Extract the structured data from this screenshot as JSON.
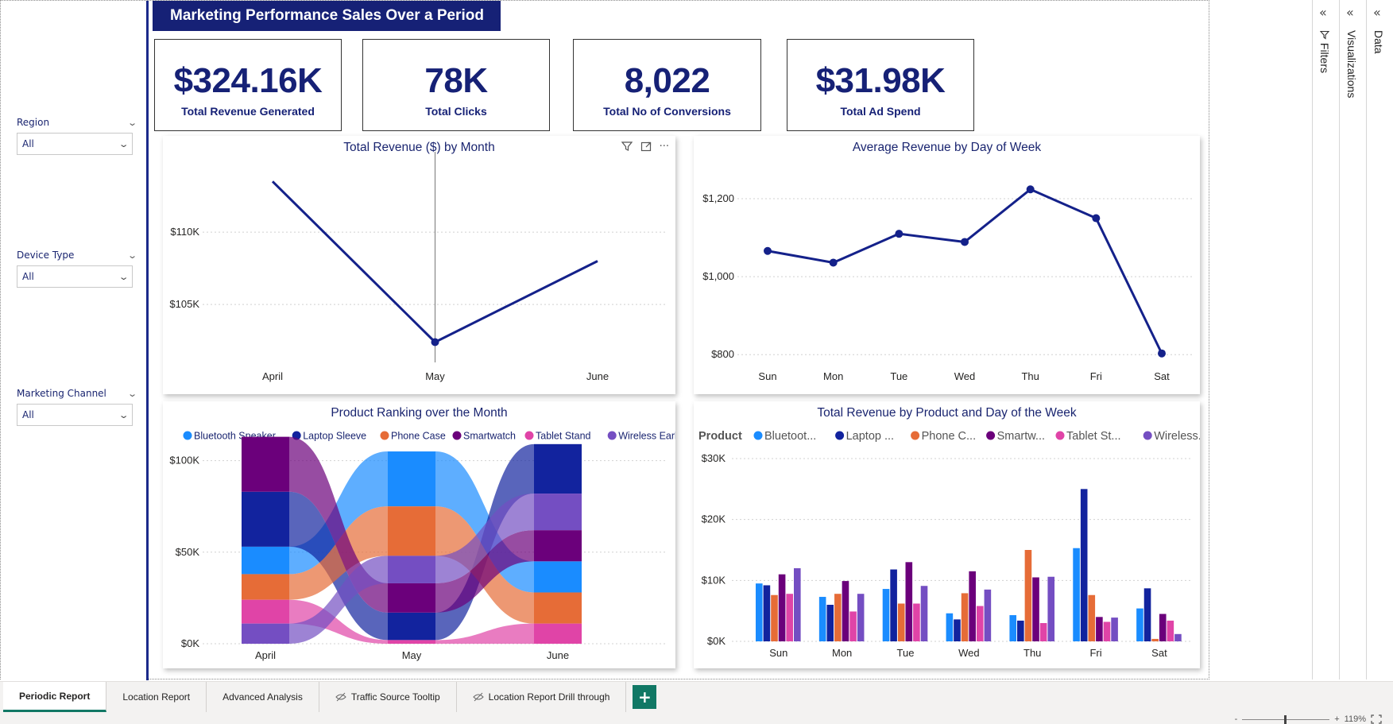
{
  "report_title": "Marketing Performance Sales Over a Period",
  "slicers": [
    {
      "label": "Region",
      "value": "All"
    },
    {
      "label": "Device Type",
      "value": "All"
    },
    {
      "label": "Marketing Channel",
      "value": "All"
    }
  ],
  "kpis": [
    {
      "value": "$324.16K",
      "label": "Total Revenue Generated"
    },
    {
      "value": "78K",
      "label": "Total Clicks"
    },
    {
      "value": "8,022",
      "label": "Total No of Conversions"
    },
    {
      "value": "$31.98K",
      "label": "Total Ad Spend"
    }
  ],
  "colors": {
    "navy": "#162176",
    "line": "#14218a",
    "bluetooth_speaker": "#1a8cff",
    "laptop_sleeve": "#12239e",
    "phone_case": "#e66c37",
    "smartwatch": "#6b007b",
    "tablet_stand": "#e044a7",
    "wireless_earbuds": "#744ec2",
    "accent_green": "#117865"
  },
  "chart_data": [
    {
      "type": "line",
      "title": "Total Revenue ($) by Month",
      "categories": [
        "April",
        "May",
        "June"
      ],
      "values": [
        113500,
        102400,
        108000
      ],
      "yticks": [
        "$105K",
        "$110K"
      ],
      "ytick_values": [
        105000,
        110000
      ],
      "ylim": [
        101000,
        115000
      ]
    },
    {
      "type": "line",
      "title": "Average Revenue by Day of Week",
      "categories": [
        "Sun",
        "Mon",
        "Tue",
        "Wed",
        "Thu",
        "Fri",
        "Sat"
      ],
      "values": [
        1066,
        1036,
        1110,
        1089,
        1224,
        1150,
        803
      ],
      "yticks": [
        "$800",
        "$1,000",
        "$1,200"
      ],
      "ytick_values": [
        800,
        1000,
        1200
      ],
      "ylim": [
        780,
        1300
      ]
    },
    {
      "type": "area",
      "title": "Product Ranking over the Month",
      "categories": [
        "April",
        "May",
        "June"
      ],
      "legend": [
        "Bluetooth Speaker",
        "Laptop Sleeve",
        "Phone Case",
        "Smartwatch",
        "Tablet Stand",
        "Wireless Earbuds"
      ],
      "series": [
        {
          "name": "Bluetooth Speaker",
          "values": [
            15000,
            30000,
            17000
          ]
        },
        {
          "name": "Laptop Sleeve",
          "values": [
            30000,
            15000,
            27000
          ]
        },
        {
          "name": "Phone Case",
          "values": [
            14000,
            27000,
            17000
          ]
        },
        {
          "name": "Smartwatch",
          "values": [
            30000,
            16000,
            17000
          ]
        },
        {
          "name": "Tablet Stand",
          "values": [
            13000,
            2000,
            11000
          ]
        },
        {
          "name": "Wireless Earbuds",
          "values": [
            11000,
            15000,
            20000
          ]
        }
      ],
      "stack_order": {
        "April": [
          "Wireless Earbuds",
          "Tablet Stand",
          "Phone Case",
          "Bluetooth Speaker",
          "Laptop Sleeve",
          "Smartwatch"
        ],
        "May": [
          "Tablet Stand",
          "Laptop Sleeve",
          "Smartwatch",
          "Wireless Earbuds",
          "Phone Case",
          "Bluetooth Speaker"
        ],
        "June": [
          "Tablet Stand",
          "Phone Case",
          "Bluetooth Speaker",
          "Smartwatch",
          "Wireless Earbuds",
          "Laptop Sleeve"
        ]
      },
      "yticks": [
        "$0K",
        "$50K",
        "$100K"
      ],
      "ytick_values": [
        0,
        50000,
        100000
      ],
      "ylim": [
        0,
        115000
      ]
    },
    {
      "type": "bar",
      "title": "Total Revenue by Product and Day of the Week",
      "legend_title": "Product",
      "legend": [
        "Bluetoot...",
        "Laptop ...",
        "Phone C...",
        "Smartw...",
        "Tablet St...",
        "Wireless..."
      ],
      "categories": [
        "Sun",
        "Mon",
        "Tue",
        "Wed",
        "Thu",
        "Fri",
        "Sat"
      ],
      "series": [
        {
          "values": [
            9500,
            7300,
            8600,
            4600,
            4300,
            15300,
            5400
          ]
        },
        {
          "values": [
            9200,
            6000,
            11800,
            3600,
            3400,
            25000,
            8700
          ]
        },
        {
          "values": [
            7600,
            7800,
            6200,
            7900,
            15000,
            7600,
            400
          ]
        },
        {
          "values": [
            11000,
            9900,
            13000,
            11500,
            10500,
            4000,
            4500
          ]
        },
        {
          "values": [
            7800,
            4900,
            6200,
            5800,
            3000,
            3200,
            3400
          ]
        },
        {
          "values": [
            12000,
            7800,
            9100,
            8500,
            10600,
            3900,
            1200
          ]
        }
      ],
      "yticks": [
        "$0K",
        "$10K",
        "$20K",
        "$30K"
      ],
      "ytick_values": [
        0,
        10000,
        20000,
        30000
      ],
      "ylim": [
        0,
        30000
      ]
    }
  ],
  "panes": {
    "filters": "Filters",
    "visualizations": "Visualizations",
    "data": "Data"
  },
  "tabs": [
    "Periodic Report",
    "Location Report",
    "Advanced Analysis",
    "Traffic Source Tooltip",
    "Location Report Drill through"
  ],
  "add_tab": "+",
  "zoom": {
    "minus": "-",
    "plus": "+",
    "value": "119%"
  },
  "icons": {
    "collapse": "«",
    "chevron": "v",
    "filter": "filter-icon",
    "focus": "focus-mode-icon",
    "more": "···"
  }
}
